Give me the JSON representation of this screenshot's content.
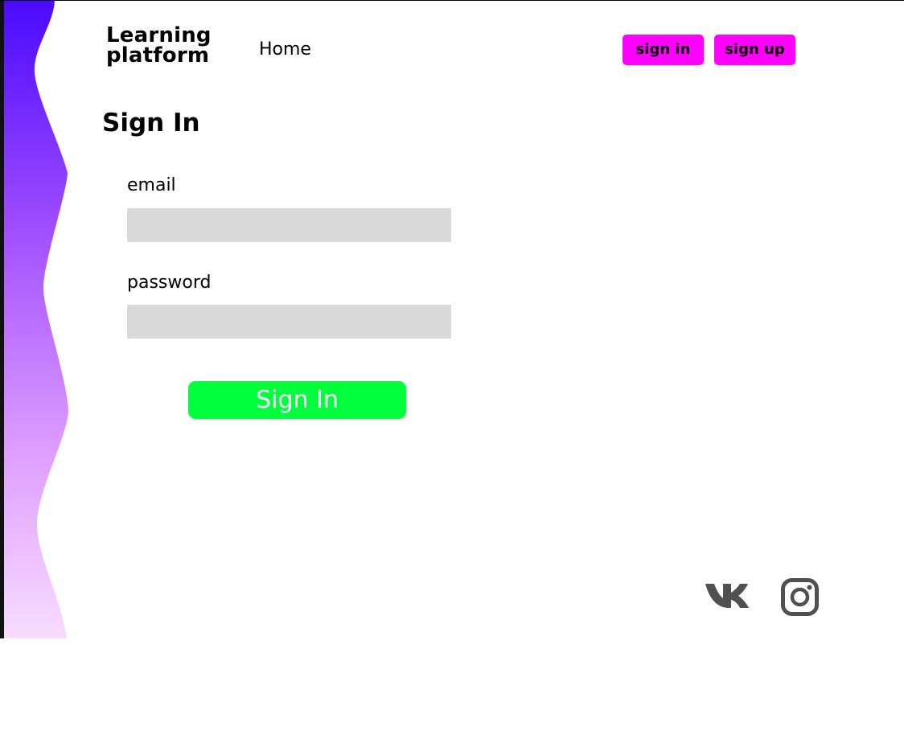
{
  "header": {
    "logo_line1": "Learning",
    "logo_line2": "platform",
    "nav_home": "Home",
    "signin_button": "sign in",
    "signup_button": "sign up"
  },
  "form": {
    "title": "Sign In",
    "email_label": "email",
    "email_value": "",
    "password_label": "password",
    "password_value": "",
    "submit_label": "Sign In"
  },
  "footer": {
    "icons": [
      "vk-icon",
      "instagram-icon"
    ]
  },
  "colors": {
    "gradient_top": "#4a0aff",
    "gradient_bottom": "#f8dcff",
    "header_button": "#ff00ff",
    "submit_button": "#00ff3c",
    "input_background": "#d9d9d9",
    "social_icon": "#505050"
  }
}
